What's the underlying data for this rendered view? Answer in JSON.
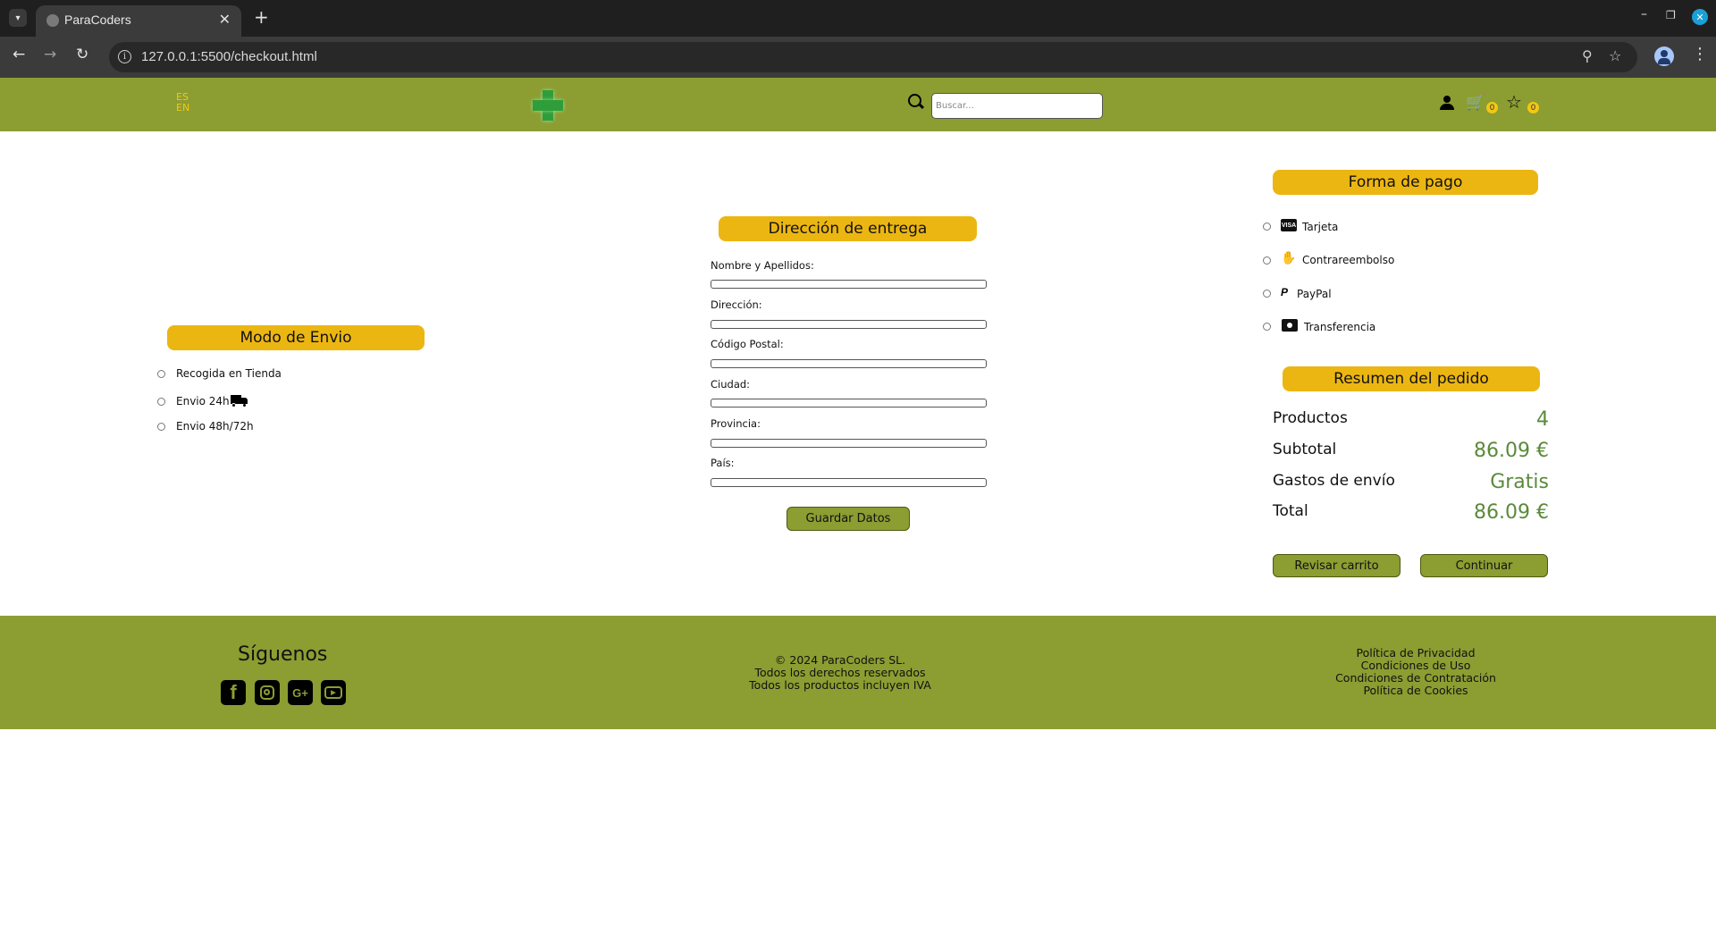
{
  "browser": {
    "tab_title": "ParaCoders",
    "url": "127.0.0.1:5500/checkout.html"
  },
  "header": {
    "lang_es": "ES",
    "lang_en": "EN",
    "search_placeholder": "Buscar...",
    "cart_count": "0",
    "favorites_count": "0"
  },
  "shipping": {
    "title": "Modo de Envio",
    "options": [
      {
        "label": "Recogida en Tienda"
      },
      {
        "label": "Envio 24h"
      },
      {
        "label": "Envio 48h/72h"
      }
    ]
  },
  "address": {
    "title": "Dirección de entrega",
    "fields": [
      {
        "label": "Nombre y Apellidos:",
        "value": ""
      },
      {
        "label": "Dirección:",
        "value": ""
      },
      {
        "label": "Código Postal:",
        "value": ""
      },
      {
        "label": "Ciudad:",
        "value": ""
      },
      {
        "label": "Provincia:",
        "value": ""
      },
      {
        "label": "País:",
        "value": ""
      }
    ],
    "save_label": "Guardar Datos"
  },
  "payment": {
    "title": "Forma de pago",
    "options": [
      {
        "label": "Tarjeta",
        "icon": "visa-card-icon"
      },
      {
        "label": "Contrareembolso",
        "icon": "hand-money-icon"
      },
      {
        "label": "PayPal",
        "icon": "paypal-icon"
      },
      {
        "label": "Transferencia",
        "icon": "money-transfer-icon"
      }
    ]
  },
  "summary": {
    "title": "Resumen del pedido",
    "rows": [
      {
        "label": "Productos",
        "value": "4"
      },
      {
        "label": "Subtotal",
        "value": "86.09 €"
      },
      {
        "label": "Gastos de envío",
        "value": "Gratis"
      },
      {
        "label": "Total",
        "value": "86.09 €"
      }
    ],
    "review_label": "Revisar carrito",
    "continue_label": "Continuar"
  },
  "footer": {
    "follow_title": "Síguenos",
    "social": [
      "facebook-icon",
      "instagram-icon",
      "google-plus-icon",
      "youtube-icon"
    ],
    "copyright": "© 2024 ParaCoders SL.",
    "rights": "Todos los derechos reservados",
    "vat": "Todos los productos incluyen IVA",
    "links": [
      "Política de Privacidad",
      "Condiciones de Uso",
      "Condiciones de Contratación",
      "Política de Cookies"
    ]
  },
  "colors": {
    "brand_olive": "#8c9d32",
    "accent_yellow": "#ecb612",
    "price_green": "#5a8a3a"
  }
}
